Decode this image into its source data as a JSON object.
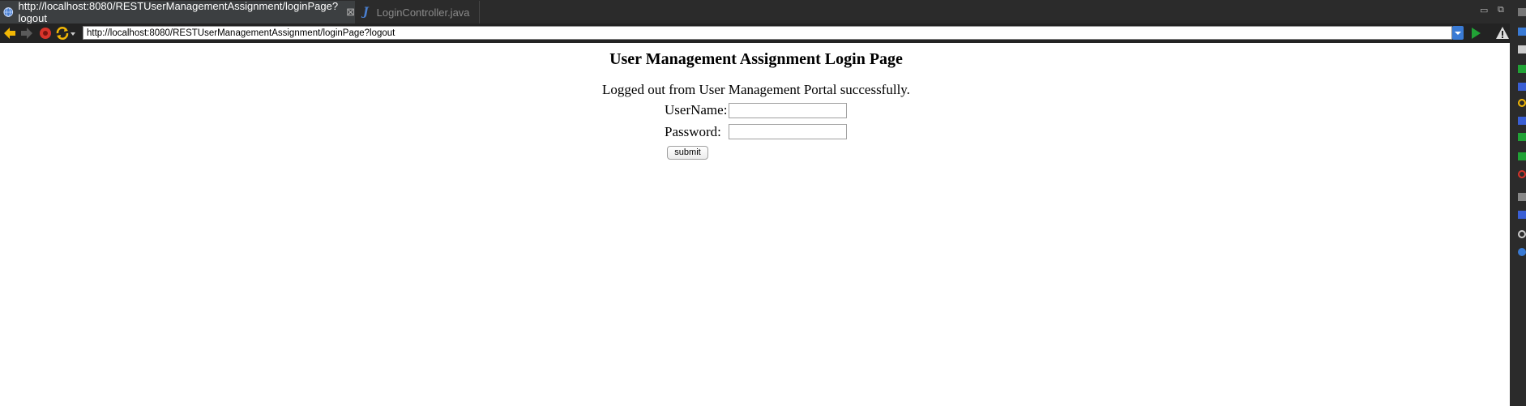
{
  "tabs": [
    {
      "label": "http://localhost:8080/RESTUserManagementAssignment/loginPage?logout",
      "active": true
    },
    {
      "label": "LoginController.java",
      "active": false
    }
  ],
  "toolbar": {
    "url": "http://localhost:8080/RESTUserManagementAssignment/loginPage?logout"
  },
  "page": {
    "title": "User Management Assignment Login Page",
    "message": "Logged out from User Management Portal successfully.",
    "username_label": "UserName:",
    "password_label": "Password:",
    "username_value": "",
    "password_value": "",
    "submit_label": "submit"
  },
  "colors": {
    "chrome_dark": "#2b2b2b",
    "back_arrow": "#f2b705",
    "stop": "#d9342b",
    "refresh": "#f2b705",
    "go": "#21a336",
    "url_dropdown": "#3a7bd5"
  }
}
